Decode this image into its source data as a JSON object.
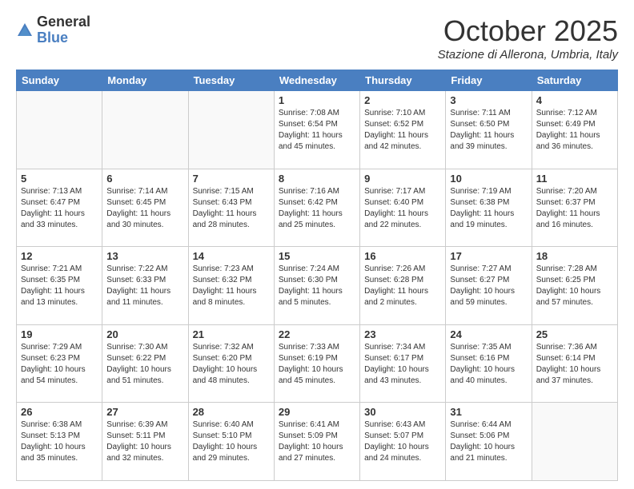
{
  "logo": {
    "general": "General",
    "blue": "Blue"
  },
  "header": {
    "month": "October 2025",
    "location": "Stazione di Allerona, Umbria, Italy"
  },
  "weekdays": [
    "Sunday",
    "Monday",
    "Tuesday",
    "Wednesday",
    "Thursday",
    "Friday",
    "Saturday"
  ],
  "weeks": [
    [
      {
        "day": "",
        "info": ""
      },
      {
        "day": "",
        "info": ""
      },
      {
        "day": "",
        "info": ""
      },
      {
        "day": "1",
        "info": "Sunrise: 7:08 AM\nSunset: 6:54 PM\nDaylight: 11 hours and 45 minutes."
      },
      {
        "day": "2",
        "info": "Sunrise: 7:10 AM\nSunset: 6:52 PM\nDaylight: 11 hours and 42 minutes."
      },
      {
        "day": "3",
        "info": "Sunrise: 7:11 AM\nSunset: 6:50 PM\nDaylight: 11 hours and 39 minutes."
      },
      {
        "day": "4",
        "info": "Sunrise: 7:12 AM\nSunset: 6:49 PM\nDaylight: 11 hours and 36 minutes."
      }
    ],
    [
      {
        "day": "5",
        "info": "Sunrise: 7:13 AM\nSunset: 6:47 PM\nDaylight: 11 hours and 33 minutes."
      },
      {
        "day": "6",
        "info": "Sunrise: 7:14 AM\nSunset: 6:45 PM\nDaylight: 11 hours and 30 minutes."
      },
      {
        "day": "7",
        "info": "Sunrise: 7:15 AM\nSunset: 6:43 PM\nDaylight: 11 hours and 28 minutes."
      },
      {
        "day": "8",
        "info": "Sunrise: 7:16 AM\nSunset: 6:42 PM\nDaylight: 11 hours and 25 minutes."
      },
      {
        "day": "9",
        "info": "Sunrise: 7:17 AM\nSunset: 6:40 PM\nDaylight: 11 hours and 22 minutes."
      },
      {
        "day": "10",
        "info": "Sunrise: 7:19 AM\nSunset: 6:38 PM\nDaylight: 11 hours and 19 minutes."
      },
      {
        "day": "11",
        "info": "Sunrise: 7:20 AM\nSunset: 6:37 PM\nDaylight: 11 hours and 16 minutes."
      }
    ],
    [
      {
        "day": "12",
        "info": "Sunrise: 7:21 AM\nSunset: 6:35 PM\nDaylight: 11 hours and 13 minutes."
      },
      {
        "day": "13",
        "info": "Sunrise: 7:22 AM\nSunset: 6:33 PM\nDaylight: 11 hours and 11 minutes."
      },
      {
        "day": "14",
        "info": "Sunrise: 7:23 AM\nSunset: 6:32 PM\nDaylight: 11 hours and 8 minutes."
      },
      {
        "day": "15",
        "info": "Sunrise: 7:24 AM\nSunset: 6:30 PM\nDaylight: 11 hours and 5 minutes."
      },
      {
        "day": "16",
        "info": "Sunrise: 7:26 AM\nSunset: 6:28 PM\nDaylight: 11 hours and 2 minutes."
      },
      {
        "day": "17",
        "info": "Sunrise: 7:27 AM\nSunset: 6:27 PM\nDaylight: 10 hours and 59 minutes."
      },
      {
        "day": "18",
        "info": "Sunrise: 7:28 AM\nSunset: 6:25 PM\nDaylight: 10 hours and 57 minutes."
      }
    ],
    [
      {
        "day": "19",
        "info": "Sunrise: 7:29 AM\nSunset: 6:23 PM\nDaylight: 10 hours and 54 minutes."
      },
      {
        "day": "20",
        "info": "Sunrise: 7:30 AM\nSunset: 6:22 PM\nDaylight: 10 hours and 51 minutes."
      },
      {
        "day": "21",
        "info": "Sunrise: 7:32 AM\nSunset: 6:20 PM\nDaylight: 10 hours and 48 minutes."
      },
      {
        "day": "22",
        "info": "Sunrise: 7:33 AM\nSunset: 6:19 PM\nDaylight: 10 hours and 45 minutes."
      },
      {
        "day": "23",
        "info": "Sunrise: 7:34 AM\nSunset: 6:17 PM\nDaylight: 10 hours and 43 minutes."
      },
      {
        "day": "24",
        "info": "Sunrise: 7:35 AM\nSunset: 6:16 PM\nDaylight: 10 hours and 40 minutes."
      },
      {
        "day": "25",
        "info": "Sunrise: 7:36 AM\nSunset: 6:14 PM\nDaylight: 10 hours and 37 minutes."
      }
    ],
    [
      {
        "day": "26",
        "info": "Sunrise: 6:38 AM\nSunset: 5:13 PM\nDaylight: 10 hours and 35 minutes."
      },
      {
        "day": "27",
        "info": "Sunrise: 6:39 AM\nSunset: 5:11 PM\nDaylight: 10 hours and 32 minutes."
      },
      {
        "day": "28",
        "info": "Sunrise: 6:40 AM\nSunset: 5:10 PM\nDaylight: 10 hours and 29 minutes."
      },
      {
        "day": "29",
        "info": "Sunrise: 6:41 AM\nSunset: 5:09 PM\nDaylight: 10 hours and 27 minutes."
      },
      {
        "day": "30",
        "info": "Sunrise: 6:43 AM\nSunset: 5:07 PM\nDaylight: 10 hours and 24 minutes."
      },
      {
        "day": "31",
        "info": "Sunrise: 6:44 AM\nSunset: 5:06 PM\nDaylight: 10 hours and 21 minutes."
      },
      {
        "day": "",
        "info": ""
      }
    ]
  ]
}
